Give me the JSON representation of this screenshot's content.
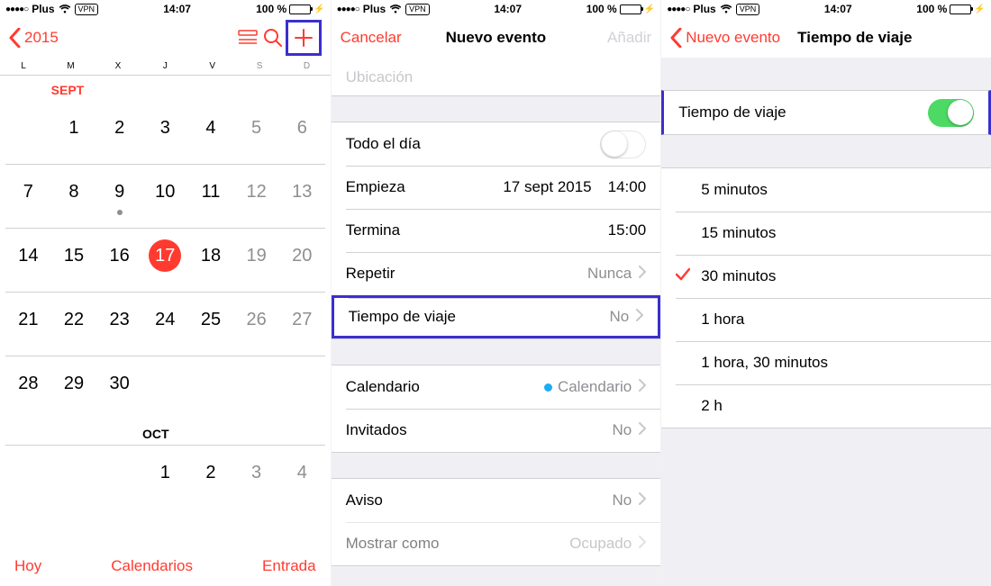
{
  "status": {
    "carrier": "Plus",
    "vpn": "VPN",
    "time": "14:07",
    "battery": "100 %"
  },
  "calendar": {
    "year": "2015",
    "dow": [
      "L",
      "M",
      "X",
      "J",
      "V",
      "S",
      "D"
    ],
    "month1_label": "SEPT",
    "month2_label": "OCT",
    "today": 17,
    "event_day": 9,
    "weeks": [
      [
        null,
        1,
        2,
        3,
        4,
        5,
        6
      ],
      [
        7,
        8,
        9,
        10,
        11,
        12,
        13
      ],
      [
        14,
        15,
        16,
        17,
        18,
        19,
        20
      ],
      [
        21,
        22,
        23,
        24,
        25,
        26,
        27
      ],
      [
        28,
        29,
        30,
        null,
        null,
        null,
        null
      ]
    ],
    "oct_week": [
      null,
      null,
      null,
      1,
      2,
      3,
      4
    ],
    "toolbar": {
      "today": "Hoy",
      "calendars": "Calendarios",
      "inbox": "Entrada"
    }
  },
  "event": {
    "nav": {
      "cancel": "Cancelar",
      "title": "Nuevo evento",
      "add": "Añadir"
    },
    "location_placeholder": "Ubicación",
    "allday": "Todo el día",
    "starts": {
      "label": "Empieza",
      "date": "17 sept 2015",
      "time": "14:00"
    },
    "ends": {
      "label": "Termina",
      "time": "15:00"
    },
    "repeat": {
      "label": "Repetir",
      "value": "Nunca"
    },
    "travel": {
      "label": "Tiempo de viaje",
      "value": "No"
    },
    "calendar_row": {
      "label": "Calendario",
      "value": "Calendario"
    },
    "invitees": {
      "label": "Invitados",
      "value": "No"
    },
    "alert": {
      "label": "Aviso",
      "value": "No"
    },
    "show_as": {
      "label": "Mostrar como",
      "value": "Ocupado"
    }
  },
  "travel": {
    "back": "Nuevo evento",
    "title": "Tiempo de viaje",
    "toggle_label": "Tiempo de viaje",
    "options": [
      "5 minutos",
      "15 minutos",
      "30 minutos",
      "1 hora",
      "1 hora, 30 minutos",
      "2 h"
    ],
    "selected_index": 2
  }
}
